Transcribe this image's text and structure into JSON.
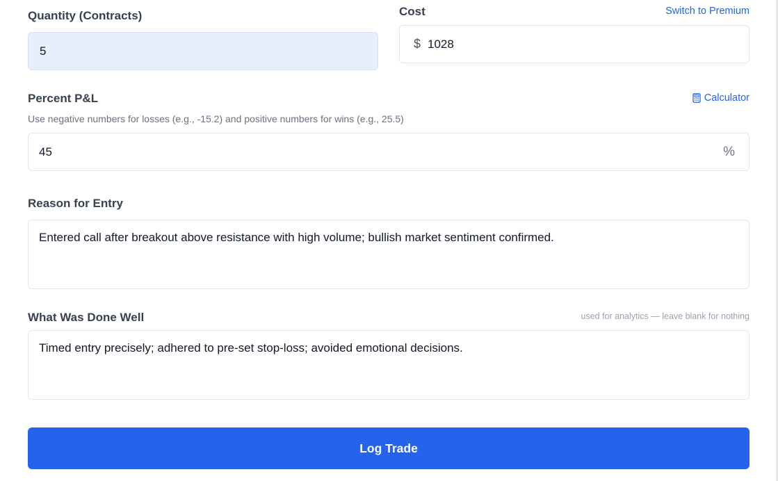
{
  "quantity": {
    "label": "Quantity (Contracts)",
    "value": "5"
  },
  "cost": {
    "label": "Cost",
    "currency_symbol": "$",
    "value": "1028",
    "premium_link": "Switch to Premium"
  },
  "percent_pnl": {
    "label": "Percent P&L",
    "calculator_link": "Calculator",
    "hint": "Use negative numbers for losses (e.g., -15.2) and positive numbers for wins (e.g., 25.5)",
    "value": "45",
    "unit": "%"
  },
  "reason_for_entry": {
    "label": "Reason for Entry",
    "value": "Entered call after breakout above resistance with high volume; bullish market sentiment confirmed."
  },
  "done_well": {
    "label": "What Was Done Well",
    "note": "used for analytics — leave blank for nothing",
    "value": "Timed entry precisely; adhered to pre-set stop-loss; avoided emotional decisions."
  },
  "submit": {
    "label": "Log Trade"
  },
  "colors": {
    "accent": "#2563eb",
    "filled_input": "#e8eefc",
    "border": "#e5e7eb"
  },
  "icons": {
    "calculator": "calculator-icon"
  }
}
